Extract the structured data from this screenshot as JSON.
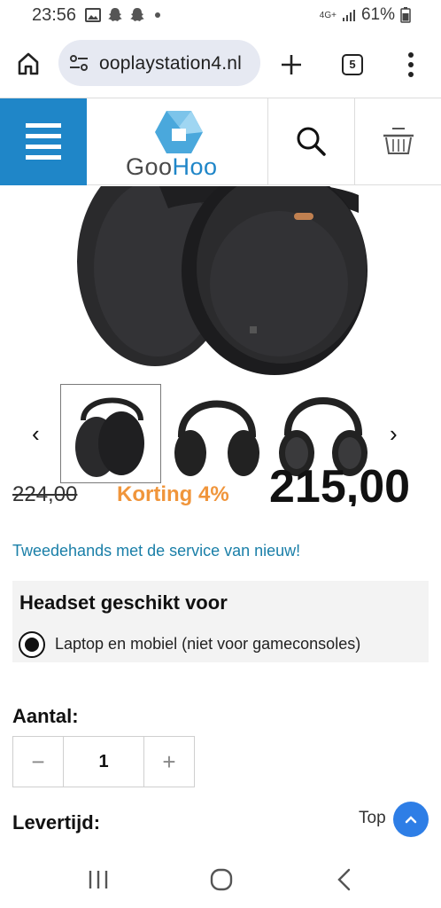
{
  "status_bar": {
    "time": "23:56",
    "network": "4G+",
    "battery": "61%"
  },
  "browser": {
    "url": "ooplaystation4.nl",
    "tab_count": "5"
  },
  "site": {
    "logo_goo": "Goo",
    "logo_hoo": "Hoo"
  },
  "product": {
    "old_price": "224,00",
    "discount": "Korting 4%",
    "new_price": "215,00",
    "tagline": "Tweedehands met de service van nieuw!"
  },
  "options": {
    "title": "Headset geschikt voor",
    "selected_label": "Laptop en mobiel (niet voor gameconsoles)"
  },
  "quantity": {
    "label": "Aantal:",
    "value": "1"
  },
  "delivery": {
    "label": "Levertijd:"
  },
  "top_button": {
    "label": "Top"
  },
  "colors": {
    "brand_blue": "#1f86c8",
    "discount_orange": "#f0953b",
    "link_teal": "#1a7fa8",
    "top_button": "#2e7ee6"
  }
}
